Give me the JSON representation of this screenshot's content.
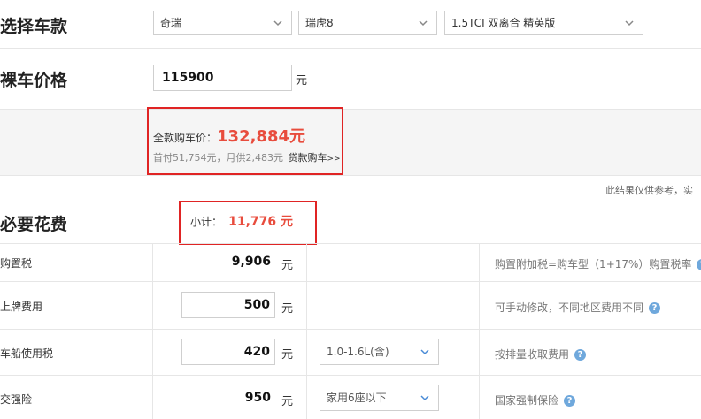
{
  "select_car": {
    "title": "选择车款",
    "brand": "奇瑞",
    "series": "瑞虎8",
    "model": "1.5TCI 双离合 精英版"
  },
  "bare_price": {
    "title": "裸车价格",
    "value": "115900",
    "unit": "元"
  },
  "full_purchase": {
    "label": "全款购车价：",
    "amount": "132,884元",
    "installment": "首付51,754元，月供2,483元",
    "loan_link": "贷款购车",
    "loan_arrow": ">>"
  },
  "disclaimer": "此结果仅供参考，实",
  "required_fees": {
    "title": "必要花费",
    "subtotal_label": "小计：",
    "subtotal_value": "11,776 元",
    "rows": [
      {
        "label": "购置税",
        "value": "9,906",
        "unit": "元",
        "option": "",
        "note": "购置附加税=购车型（1+17%）购置税率"
      },
      {
        "label": "上牌费用",
        "value": "500",
        "unit": "元",
        "option": "",
        "note": "可手动修改，不同地区费用不同"
      },
      {
        "label": "车船使用税",
        "value": "420",
        "unit": "元",
        "option": "1.0-1.6L(含)",
        "note": "按排量收取费用"
      },
      {
        "label": "交强险",
        "value": "950",
        "unit": "元",
        "option": "家用6座以下",
        "note": "国家强制保险"
      }
    ]
  },
  "colors": {
    "accent_red": "#e84c3d",
    "box_red": "#e02424",
    "help_blue": "#6fa8dc"
  },
  "icons": {
    "dropdown": "chevron-down-icon",
    "help": "question-circle-icon"
  }
}
